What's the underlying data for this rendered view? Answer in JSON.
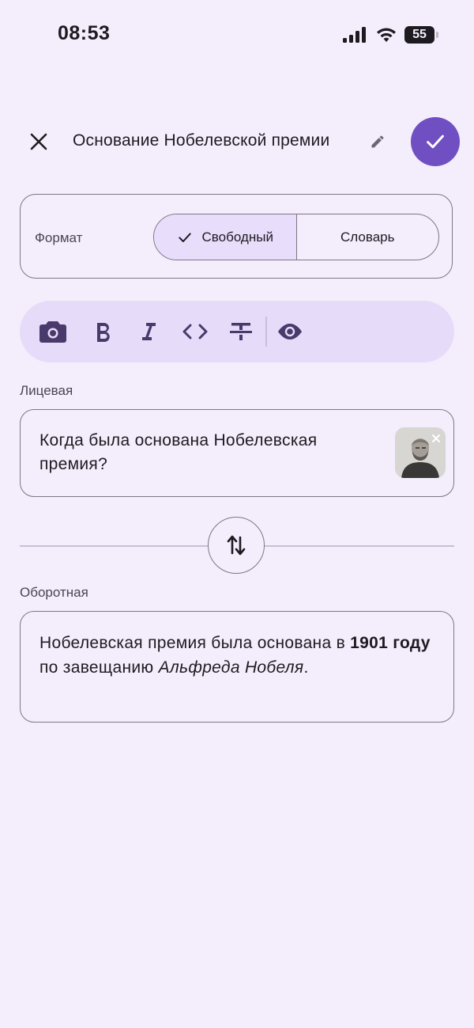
{
  "status_bar": {
    "time": "08:53",
    "battery": "55"
  },
  "header": {
    "title": "Основание Нобелевской премии"
  },
  "format": {
    "label": "Формат",
    "options": [
      {
        "label": "Свободный",
        "selected": true
      },
      {
        "label": "Словарь",
        "selected": false
      }
    ]
  },
  "toolbar": {
    "tools": [
      "camera-icon",
      "bold-icon",
      "italic-icon",
      "code-icon",
      "strikethrough-icon",
      "preview-eye-icon"
    ]
  },
  "front": {
    "label": "Лицевая",
    "text": "Когда была основана Нобелевская премия?"
  },
  "back": {
    "label": "Оборотная",
    "text_part1": "Нобелевская премия была основана в ",
    "text_bold": "1901 году",
    "text_part2": " по завещанию ",
    "text_italic": "Альфреда Нобеля",
    "text_part3": "."
  },
  "colors": {
    "background": "#f4edfc",
    "accent": "#6f4fc2",
    "selected_segment": "#e8ddfb",
    "toolbar": "#e6dcf9",
    "icon": "#4a3a6b"
  }
}
